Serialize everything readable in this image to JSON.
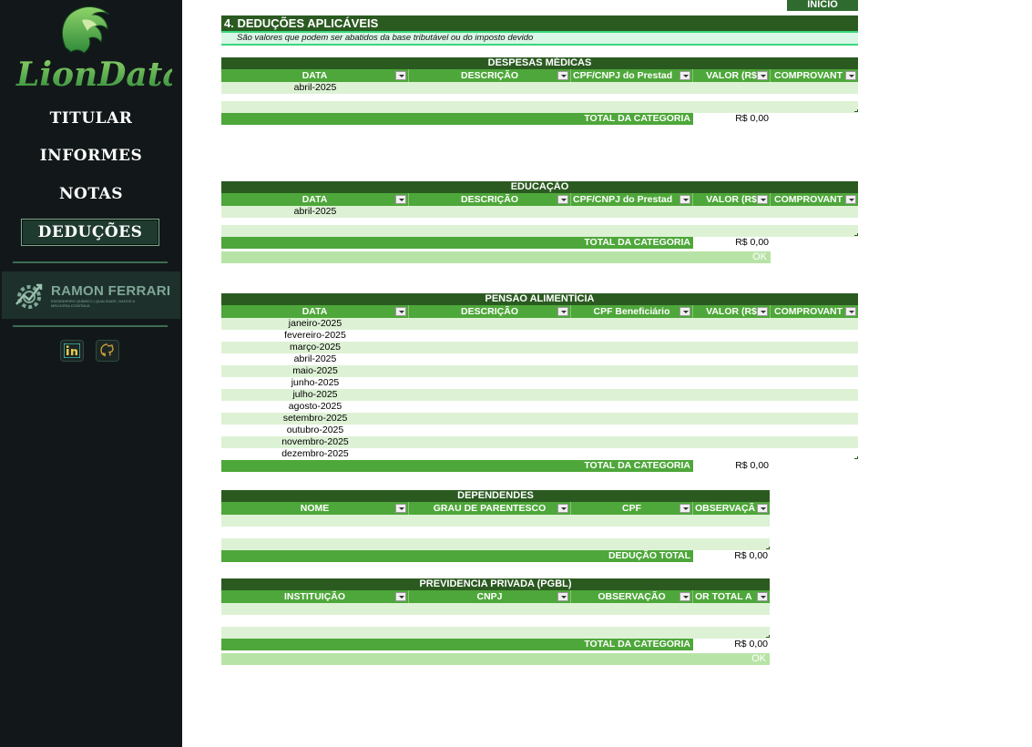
{
  "sidebar": {
    "logo_text": "LionData",
    "nav": [
      "TITULAR",
      "INFORMES",
      "NOTAS",
      "DEDUÇÕES"
    ],
    "brand_name": "RAMON FERRARI",
    "brand_sub": "ENGENHEIRO QUÍMICO | QUALIDADE, DADOS & MELHORIA CONTÍNUA",
    "social": [
      "linkedin-icon",
      "github-icon"
    ]
  },
  "top": {
    "inicio_label": "INÍCIO"
  },
  "section": {
    "title": "4. DEDUÇÕES APLICÁVEIS",
    "subtitle": "São valores que podem ser abatidos da base tributável ou do imposto devido"
  },
  "despesas": {
    "title": "DESPESAS MÉDICAS",
    "headers": [
      "DATA",
      "DESCRIÇÃO",
      "CPF/CNPJ do Prestad",
      "VALOR (R$",
      "COMPROVANT"
    ],
    "rows": [
      "abril-2025",
      ""
    ],
    "total_label": "TOTAL DA CATEGORIA",
    "total_value": "R$ 0,00"
  },
  "educacao": {
    "title": "EDUCAÇÃO",
    "headers": [
      "DATA",
      "DESCRIÇÃO",
      "CPF/CNPJ do Prestad",
      "VALOR (R$",
      "COMPROVANT"
    ],
    "rows": [
      "abril-2025",
      ""
    ],
    "total_label": "TOTAL DA CATEGORIA",
    "total_value": "R$ 0,00",
    "ok": "OK"
  },
  "pensao": {
    "title": "PENSÃO ALIMENTÍCIA",
    "headers": [
      "DATA",
      "DESCRIÇÃO",
      "CPF Beneficiário",
      "VALOR (R$",
      "COMPROVANT"
    ],
    "rows": [
      "janeiro-2025",
      "fevereiro-2025",
      "março-2025",
      "abril-2025",
      "maio-2025",
      "junho-2025",
      "julho-2025",
      "agosto-2025",
      "setembro-2025",
      "outubro-2025",
      "novembro-2025",
      "dezembro-2025"
    ],
    "total_label": "TOTAL DA CATEGORIA",
    "total_value": "R$ 0,00"
  },
  "dependentes": {
    "title": "DEPENDENDES",
    "headers": [
      "NOME",
      "GRAU  DE PARENTESCO",
      "CPF",
      "OBSERVAÇÃ"
    ],
    "total_label": "DEDUÇÃO TOTAL",
    "total_value": "R$ 0,00"
  },
  "previdencia": {
    "title": "PREVIDENCIA PRIVADA (PGBL)",
    "headers": [
      "INSTITUIÇÃO",
      "CNPJ",
      "OBSERVAÇÃO",
      "OR TOTAL A"
    ],
    "total_label": "TOTAL DA CATEGORIA",
    "total_value": "R$ 0,00",
    "ok": "OK"
  }
}
